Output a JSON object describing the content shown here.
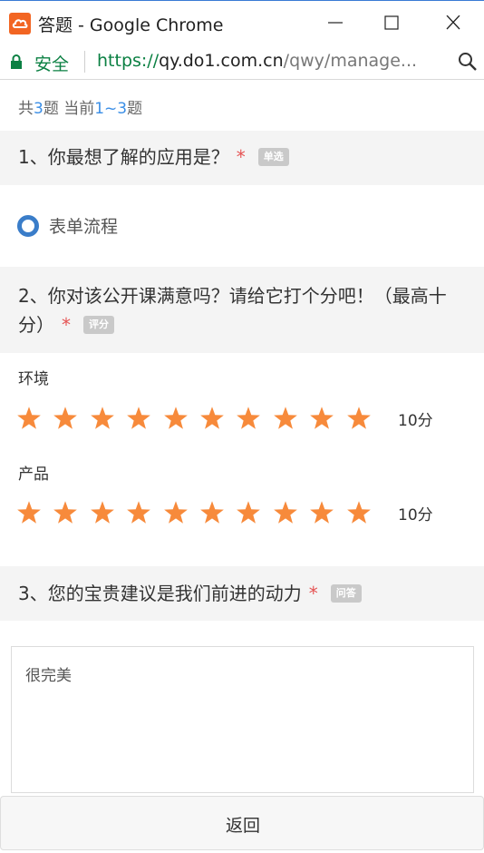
{
  "window": {
    "title": "答题 - Google Chrome"
  },
  "addressbar": {
    "secure_label": "安全",
    "url_scheme": "https://",
    "url_host": "qy.do1.com.cn",
    "url_path": "/qwy/manage..."
  },
  "counter": {
    "prefix": "共",
    "total": "3",
    "middle": "题 当前",
    "range": "1~3",
    "suffix": "题"
  },
  "questions": [
    {
      "title": "1、你最想了解的应用是？",
      "required_mark": "*",
      "type_tag": "单选",
      "options": [
        {
          "label": "表单流程",
          "selected": true
        }
      ]
    },
    {
      "title": "2、你对该公开课满意吗？请给它打个分吧！（最高十分）",
      "required_mark": "*",
      "type_tag": "评分",
      "ratings": [
        {
          "label": "环境",
          "stars": 10,
          "max_stars": 10,
          "score_text": "10分"
        },
        {
          "label": "产品",
          "stars": 10,
          "max_stars": 10,
          "score_text": "10分"
        }
      ]
    },
    {
      "title": "3、您的宝贵建议是我们前进的动力",
      "required_mark": "*",
      "type_tag": "问答",
      "answer": "很完美"
    }
  ],
  "footer": {
    "back_label": "返回"
  },
  "colors": {
    "accent": "#3a8ee6",
    "star": "#f78a3b",
    "required": "#e55353",
    "secure": "#0b8043",
    "radio": "#3a7dc9"
  },
  "icons": {
    "app": "cloud-icon",
    "lock": "lock-icon",
    "zoom": "magnifier-icon",
    "star": "star-icon",
    "radio": "radio-selected-icon"
  }
}
